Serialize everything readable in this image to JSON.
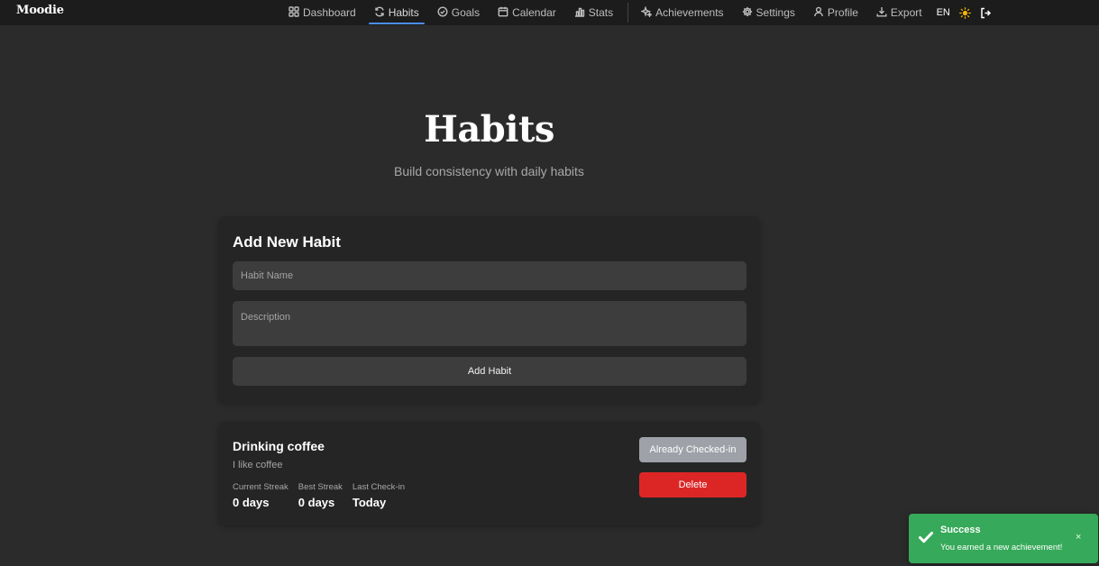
{
  "app": {
    "brand": "Moodie"
  },
  "nav": {
    "items": [
      {
        "label": "Dashboard",
        "icon": "grid-icon"
      },
      {
        "label": "Habits",
        "icon": "refresh-icon",
        "active": true
      },
      {
        "label": "Goals",
        "icon": "check-circle-icon"
      },
      {
        "label": "Calendar",
        "icon": "calendar-icon"
      },
      {
        "label": "Stats",
        "icon": "bar-chart-icon"
      },
      {
        "label": "Achievements",
        "icon": "sparkles-icon"
      },
      {
        "label": "Settings",
        "icon": "gear-icon"
      },
      {
        "label": "Profile",
        "icon": "user-icon"
      },
      {
        "label": "Export",
        "icon": "download-icon"
      }
    ],
    "language": "EN",
    "theme_icon": "sun-icon",
    "logout_icon": "logout-icon"
  },
  "page": {
    "title": "Habits",
    "subtitle": "Build consistency with daily habits"
  },
  "add_habit": {
    "title": "Add New Habit",
    "name_placeholder": "Habit Name",
    "name_value": "",
    "description_placeholder": "Description",
    "description_value": "",
    "submit_label": "Add Habit"
  },
  "habits": [
    {
      "name": "Drinking coffee",
      "description": "I like coffee",
      "stats": [
        {
          "label": "Current Streak",
          "value": "0 days"
        },
        {
          "label": "Best Streak",
          "value": "0 days"
        },
        {
          "label": "Last Check-in",
          "value": "Today"
        }
      ],
      "checkin_label": "Already Checked-in",
      "delete_label": "Delete"
    }
  ],
  "toast": {
    "title": "Success",
    "message": "You earned a new achievement!",
    "close": "×"
  },
  "colors": {
    "background": "#2b2b2b",
    "topbar": "#1c1c1c",
    "card": "#252525",
    "accent": "#4b8ef5",
    "danger": "#dc2626",
    "success": "#37a95a",
    "disabled": "#9ea1a8"
  }
}
